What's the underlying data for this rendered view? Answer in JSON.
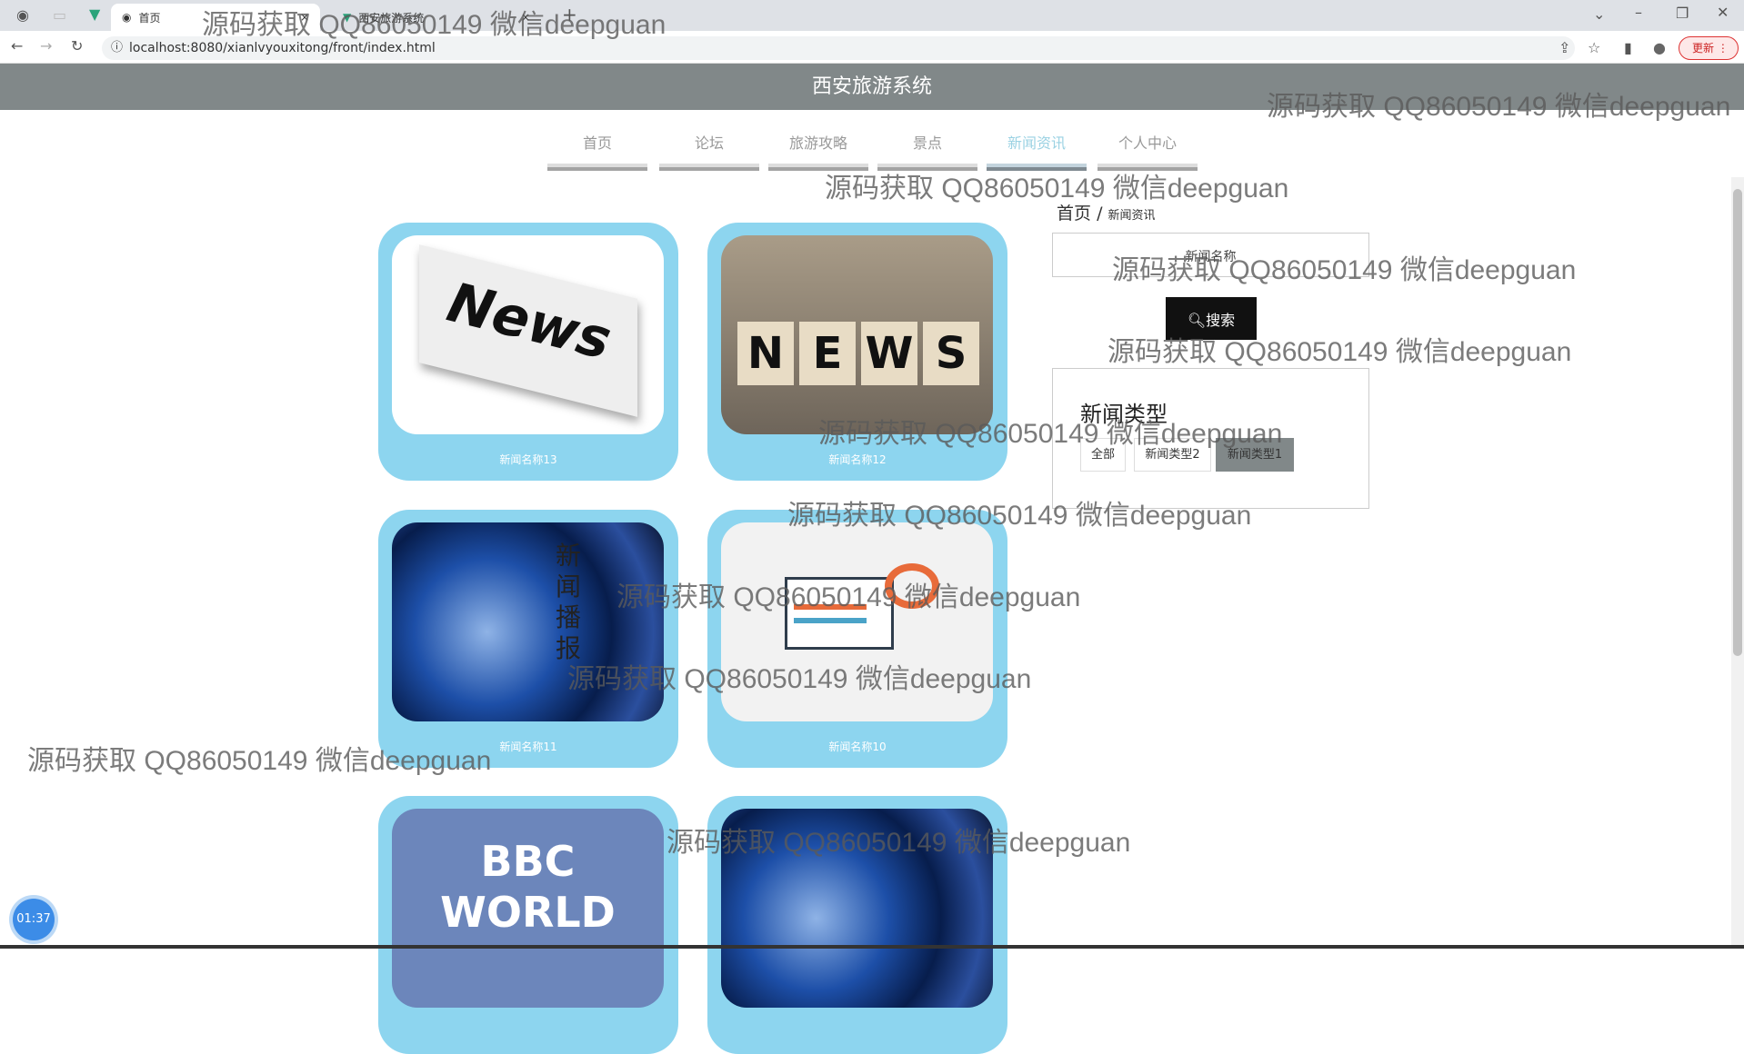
{
  "browser": {
    "tabs": [
      {
        "label": "首页",
        "active": true
      },
      {
        "label": "西安旅游系统",
        "active": false
      }
    ],
    "url": "localhost:8080/xianlvyouxitong/front/index.html",
    "update_label": "更新"
  },
  "header": {
    "title": "西安旅游系统"
  },
  "nav": [
    {
      "label": "首页"
    },
    {
      "label": "论坛"
    },
    {
      "label": "旅游攻略"
    },
    {
      "label": "景点"
    },
    {
      "label": "新闻资讯",
      "active": true
    },
    {
      "label": "个人中心"
    }
  ],
  "accent_color": "#8dd5ef",
  "breadcrumb": {
    "home": "首页",
    "separator": "/",
    "current": "新闻资讯"
  },
  "search": {
    "placeholder": "新闻名称",
    "button": "搜索"
  },
  "types": {
    "title": "新闻类型",
    "options": [
      {
        "label": "全部"
      },
      {
        "label": "新闻类型2"
      },
      {
        "label": "新闻类型1",
        "active": true
      }
    ]
  },
  "news": [
    {
      "title": "新闻名称13",
      "image": "newspaper-news"
    },
    {
      "title": "新闻名称12",
      "image": "news-dice"
    },
    {
      "title": "新闻名称11",
      "image": "globe-broadcast",
      "overlay": "新闻播报"
    },
    {
      "title": "新闻名称10",
      "image": "news-illustration"
    },
    {
      "title": "",
      "image": "bbc-world-news",
      "overlay": "BBC WORLD"
    },
    {
      "title": "",
      "image": "globe-broadcast"
    }
  ],
  "timer": "01:37",
  "watermark": "源码获取 QQ86050149 微信deepguan"
}
